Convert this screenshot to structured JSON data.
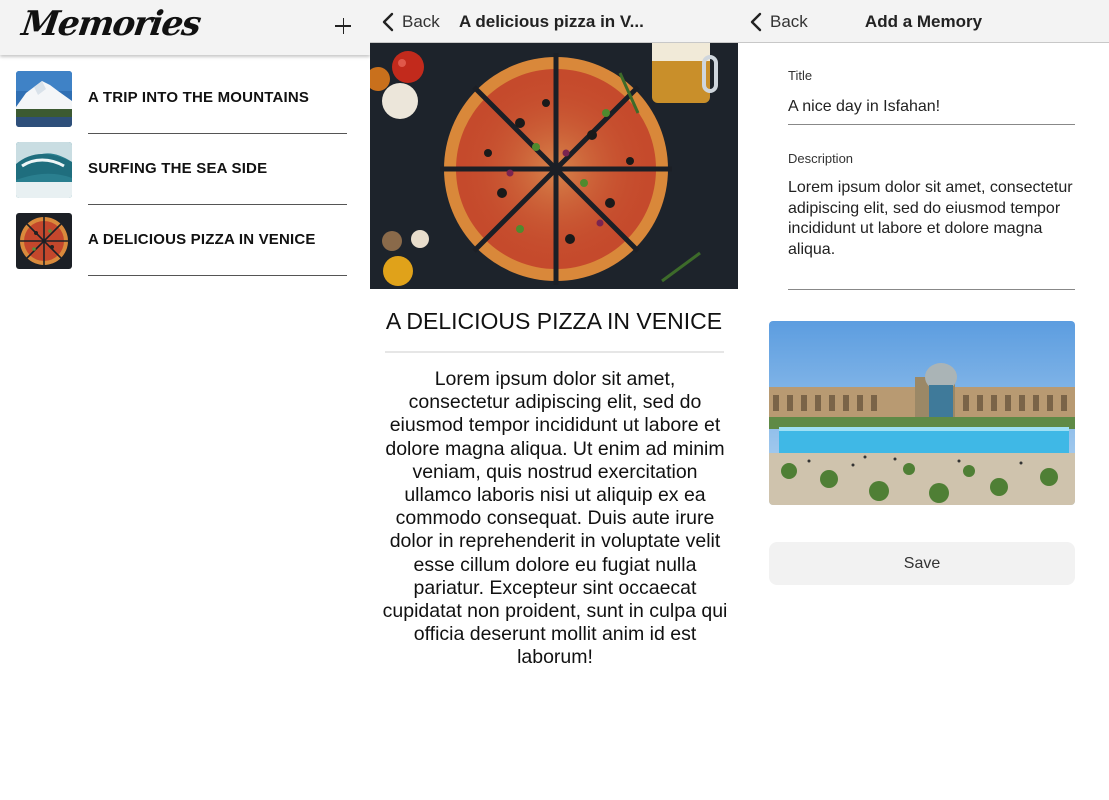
{
  "list_screen": {
    "title": "Memories",
    "items": [
      {
        "title": "A TRIP INTO THE MOUNTAINS"
      },
      {
        "title": "SURFING THE SEA SIDE"
      },
      {
        "title": "A DELICIOUS PIZZA IN VENICE"
      }
    ]
  },
  "detail_screen": {
    "back_label": "Back",
    "nav_title": "A delicious pizza in V...",
    "title": "A DELICIOUS PIZZA IN VENICE",
    "body": "Lorem ipsum dolor sit amet, consectetur adipiscing elit, sed do eiusmod tempor incididunt ut labore et dolore magna aliqua. Ut enim ad minim veniam, quis nostrud exercitation ullamco laboris nisi ut aliquip ex ea commodo consequat. Duis aute irure dolor in reprehenderit in voluptate velit esse cillum dolore eu fugiat nulla pariatur. Excepteur sint occaecat cupidatat non proident, sunt in culpa qui officia deserunt mollit anim id est laborum!"
  },
  "add_screen": {
    "back_label": "Back",
    "nav_title": "Add a Memory",
    "title_label": "Title",
    "title_value": "A nice day in Isfahan!",
    "description_label": "Description",
    "description_value": "Lorem ipsum dolor sit amet, consectetur adipiscing elit, sed do eiusmod tempor incididunt ut labore et dolore magna aliqua.",
    "save_label": "Save"
  },
  "colors": {
    "navbar_bg": "#f3f3f3",
    "text": "#111111",
    "save_button_bg": "#f2f2f2"
  }
}
